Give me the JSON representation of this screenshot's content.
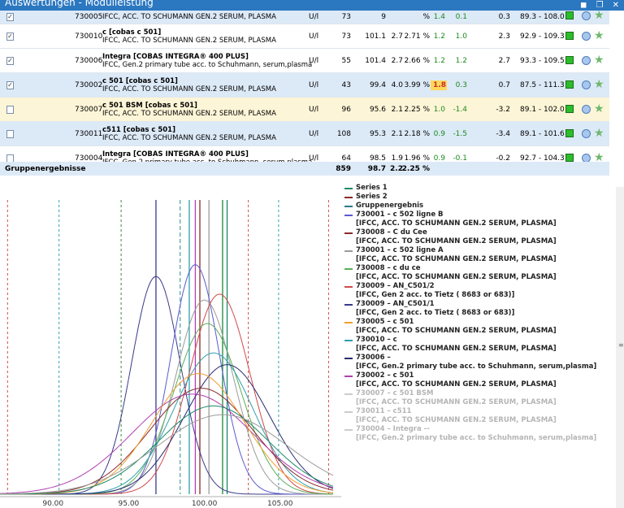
{
  "window": {
    "title": "Auswertungen - Modulleistung",
    "icons": [
      "◼",
      "❐",
      "✕"
    ]
  },
  "scroll_up_label": "▾",
  "rows": [
    {
      "checked": true,
      "id": "730005",
      "name1": "",
      "name2": "IFCC, ACC. TO SCHUMANN GEN.2 SERUM, PLASMA",
      "unit": "U/l",
      "n": "73",
      "mean": "9",
      "sd": "",
      "cv": "% ",
      "b1": "1.4",
      "b2": "0.1",
      "d": "0.3",
      "range": "89.3 - 108.0"
    },
    {
      "checked": true,
      "id": "730010",
      "name1": "c [cobas c 501]",
      "name2": "IFCC, ACC. TO SCHUMANN GEN.2 SERUM, PLASMA",
      "unit": "U/l",
      "n": "73",
      "mean": "101.1",
      "sd": "2.7",
      "cv": "2.71 %",
      "b1": "1.2",
      "b2": "1.0",
      "d": "2.3",
      "range": "92.9 - 109.3"
    },
    {
      "checked": true,
      "id": "730006",
      "name1": "Integra [COBAS INTEGRA® 400 PLUS]",
      "name2": "IFCC, Gen.2 primary tube acc. to Schuhmann, serum,plasma",
      "unit": "U/l",
      "n": "55",
      "mean": "101.4",
      "sd": "2.7",
      "cv": "2.66 %",
      "b1": "1.2",
      "b2": "1.2",
      "d": "2.7",
      "range": "93.3 - 109.5"
    },
    {
      "checked": true,
      "id": "730002",
      "name1": "c 501 [cobas c 501]",
      "name2": "IFCC, ACC. TO SCHUMANN GEN.2 SERUM, PLASMA",
      "unit": "U/l",
      "n": "43",
      "mean": "99.4",
      "sd": "4.0",
      "cv": "3.99 %",
      "b1": "1.8",
      "b2": "0.3",
      "d": "0.7",
      "range": "87.5 - 111.3"
    },
    {
      "checked": false,
      "id": "730007",
      "name1": "c 501 BSM [cobas c 501]",
      "name2": "IFCC, ACC. TO SCHUMANN GEN.2 SERUM, PLASMA",
      "unit": "U/l",
      "n": "96",
      "mean": "95.6",
      "sd": "2.1",
      "cv": "2.25 %",
      "b1": "1.0",
      "b2": "-1.4",
      "d": "-3.2",
      "range": "89.1 - 102.0"
    },
    {
      "checked": false,
      "id": "730011",
      "name1": "c511 [cobas c 501]",
      "name2": "IFCC, ACC. TO SCHUMANN GEN.2 SERUM, PLASMA",
      "unit": "U/l",
      "n": "108",
      "mean": "95.3",
      "sd": "2.1",
      "cv": "2.18 %",
      "b1": "0.9",
      "b2": "-1.5",
      "d": "-3.4",
      "range": "89.1 - 101.6"
    },
    {
      "checked": false,
      "id": "730004",
      "name1": "Integra [COBAS INTEGRA® 400 PLUS]",
      "name2": "IFCC, Gen.2 primary tube acc. to Schuhmann, serum,plasma",
      "unit": "U/l",
      "n": "64",
      "mean": "98.5",
      "sd": "1.9",
      "cv": "1.96 %",
      "b1": "0.9",
      "b2": "-0.1",
      "d": "-0.2",
      "range": "92.7 - 104.3"
    }
  ],
  "summary": {
    "label": "Gruppenergebnisse",
    "n": "859",
    "mean": "98.7",
    "sd": "2.2",
    "cv": "2.25 %"
  },
  "legend": [
    {
      "l1": "Series 1",
      "l2": "",
      "color": "#1a8a6a",
      "faded": false
    },
    {
      "l1": "Series 2",
      "l2": "",
      "color": "#8b2a2a",
      "faded": false
    },
    {
      "l1": "Gruppenergebnis",
      "l2": "",
      "color": "#2a7a8a",
      "faded": false
    },
    {
      "l1": "730001 – c 502 ligne B",
      "l2": "[IFCC, ACC. TO SCHUMANN GEN.2 SERUM, PLASMA]",
      "color": "#5a5ad0",
      "faded": false
    },
    {
      "l1": "730008 – C du Cee",
      "l2": "[IFCC, ACC. TO SCHUMANN GEN.2 SERUM, PLASMA]",
      "color": "#8a2a2a",
      "faded": false
    },
    {
      "l1": "730001 – c 502 ligne A",
      "l2": "[IFCC, ACC. TO SCHUMANN GEN.2 SERUM, PLASMA]",
      "color": "#9a9a9a",
      "faded": false
    },
    {
      "l1": "730008 – c du ce",
      "l2": "[IFCC, ACC. TO SCHUMANN GEN.2 SERUM, PLASMA]",
      "color": "#5ab05a",
      "faded": false
    },
    {
      "l1": "730009 – AN_C501/2",
      "l2": "[IFCC, Gen 2 acc. to Tietz ( 8683 or 683)]",
      "color": "#d04a4a",
      "faded": false
    },
    {
      "l1": "730009 – AN_C501/1",
      "l2": "[IFCC, Gen 2 acc. to Tietz ( 8683 or 683)]",
      "color": "#3a3a8a",
      "faded": false
    },
    {
      "l1": "730005 – c 501",
      "l2": "[IFCC, ACC. TO SCHUMANN GEN.2 SERUM, PLASMA]",
      "color": "#f0a030",
      "faded": false
    },
    {
      "l1": "730010 – c",
      "l2": "[IFCC, ACC. TO SCHUMANN GEN.2 SERUM, PLASMA]",
      "color": "#30a0b0",
      "faded": false
    },
    {
      "l1": "730006 –",
      "l2": "[IFCC, Gen.2 primary tube acc. to Schuhmann, serum,plasma]",
      "color": "#2a2a70",
      "faded": false
    },
    {
      "l1": "730002 – c 501",
      "l2": "[IFCC, ACC. TO SCHUMANN GEN.2 SERUM, PLASMA]",
      "color": "#b040b0",
      "faded": false
    },
    {
      "l1": "730007 – c 501 BSM",
      "l2": "[IFCC, ACC. TO SCHUMANN GEN.2 SERUM, PLASMA]",
      "color": "#cccccc",
      "faded": true
    },
    {
      "l1": "730011 – c511",
      "l2": "[IFCC, ACC. TO SCHUMANN GEN.2 SERUM, PLASMA]",
      "color": "#cccccc",
      "faded": true
    },
    {
      "l1": "730004 – Integra --",
      "l2": "[IFCC, Gen.2 primary tube acc. to Schuhmann, serum,plasma]",
      "color": "#cccccc",
      "faded": true
    }
  ],
  "chart_data": {
    "type": "line",
    "x_ticks": [
      "90.00",
      "95.00",
      "100.00",
      "105.00"
    ],
    "xlim": [
      86.5,
      108.5
    ],
    "ylim": [
      0,
      1
    ],
    "series": [
      {
        "color": "#3a3a8a",
        "mean": 96.8,
        "sd": 1.6,
        "amp": 0.74
      },
      {
        "color": "#5a5ad0",
        "mean": 99.4,
        "sd": 1.6,
        "amp": 0.78
      },
      {
        "color": "#9a9a9a",
        "mean": 100.0,
        "sd": 1.9,
        "amp": 0.66
      },
      {
        "color": "#d04a4a",
        "mean": 101.0,
        "sd": 2.0,
        "amp": 0.68
      },
      {
        "color": "#5ab05a",
        "mean": 100.2,
        "sd": 2.2,
        "amp": 0.58
      },
      {
        "color": "#30a0b0",
        "mean": 100.6,
        "sd": 2.6,
        "amp": 0.48
      },
      {
        "color": "#2a2a70",
        "mean": 101.5,
        "sd": 2.8,
        "amp": 0.44
      },
      {
        "color": "#8b2a2a",
        "mean": 99.8,
        "sd": 3.4,
        "amp": 0.36
      },
      {
        "color": "#b040b0",
        "mean": 99.2,
        "sd": 4.0,
        "amp": 0.34
      },
      {
        "color": "#f0a030",
        "mean": 99.6,
        "sd": 3.0,
        "amp": 0.41
      },
      {
        "color": "#1a8a6a",
        "mean": 100.6,
        "sd": 3.6,
        "amp": 0.3
      },
      {
        "color": "#9a9a9a",
        "mean": 101.2,
        "sd": 4.3,
        "amp": 0.27
      }
    ],
    "vlines": [
      {
        "x": 87.0,
        "color": "#d04a4a",
        "dash": "3,3"
      },
      {
        "x": 90.4,
        "color": "#30a0b0",
        "dash": "3,3"
      },
      {
        "x": 94.5,
        "color": "#3a8a3a",
        "dash": "3,3"
      },
      {
        "x": 96.8,
        "color": "#3a3a8a",
        "dash": ""
      },
      {
        "x": 98.4,
        "color": "#2a8a8a",
        "dash": "5,3"
      },
      {
        "x": 99.0,
        "color": "#30a0b0",
        "dash": ""
      },
      {
        "x": 99.4,
        "color": "#b040b0",
        "dash": ""
      },
      {
        "x": 99.7,
        "color": "#8b2a2a",
        "dash": ""
      },
      {
        "x": 100.3,
        "color": "#9a9a9a",
        "dash": ""
      },
      {
        "x": 101.2,
        "color": "#1a8a3a",
        "dash": ""
      },
      {
        "x": 101.5,
        "color": "#1a8a6a",
        "dash": ""
      },
      {
        "x": 102.9,
        "color": "#d04a4a",
        "dash": "3,3"
      },
      {
        "x": 104.9,
        "color": "#30a0b0",
        "dash": "3,3"
      },
      {
        "x": 108.2,
        "color": "#d04a4a",
        "dash": "3,3"
      }
    ]
  }
}
